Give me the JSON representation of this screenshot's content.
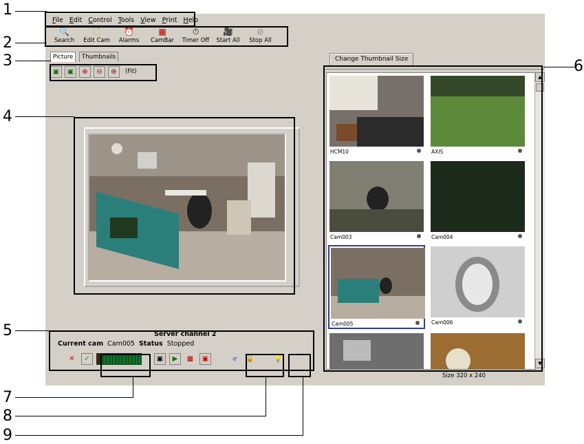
{
  "callouts": [
    "1",
    "2",
    "3",
    "4",
    "5",
    "6",
    "7",
    "8",
    "9"
  ],
  "menu": [
    "File",
    "Edit",
    "Control",
    "Tools",
    "View",
    "Print",
    "Help"
  ],
  "toolbar": [
    {
      "label": "Search",
      "icon": "search-icon"
    },
    {
      "label": "Edit Cam",
      "icon": "page-icon"
    },
    {
      "label": "Alarms",
      "icon": "alarm-icon"
    },
    {
      "label": "CamBar",
      "icon": "cambar-icon"
    },
    {
      "label": "Timer Off",
      "icon": "timer-icon"
    },
    {
      "label": "Start All",
      "icon": "camera-icon"
    },
    {
      "label": "Stop All",
      "icon": "stop-icon"
    }
  ],
  "tabs": {
    "picture": "Picture",
    "thumbnails": "Thumbnails"
  },
  "picture_toolbar": {
    "fit": "(Fit)"
  },
  "status": {
    "title": "Server channel 2",
    "current_cam_label": "Current cam",
    "current_cam_value": "Cam005",
    "status_label": "Status",
    "status_value": "Stopped"
  },
  "thumbnails": {
    "button": "Change Thumbnail Size",
    "size": "Size 320 x 240",
    "items": [
      "HCM10",
      "AXIS",
      "Cam003",
      "Cam004",
      "Cam005",
      "Cam006",
      "",
      ""
    ]
  }
}
